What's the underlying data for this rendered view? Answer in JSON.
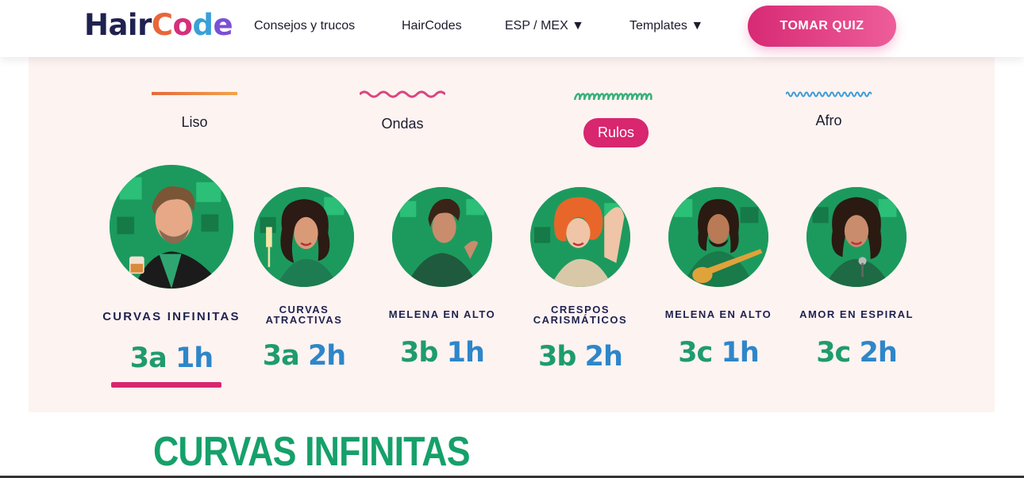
{
  "header": {
    "logo": {
      "hair": "Hair",
      "c": "C",
      "o": "o",
      "d": "d",
      "e": "e"
    },
    "nav": [
      {
        "label": "Consejos y trucos"
      },
      {
        "label": "HairCodes"
      },
      {
        "label": "ESP / MEX ▼"
      },
      {
        "label": "Templates ▼"
      }
    ],
    "cta_label": "TOMAR QUIZ"
  },
  "hair_types": [
    {
      "label": "Liso",
      "icon": "straight-line-icon",
      "selected": false
    },
    {
      "label": "Ondas",
      "icon": "wavy-line-icon",
      "selected": false
    },
    {
      "label": "Rulos",
      "icon": "curly-line-icon",
      "selected": true
    },
    {
      "label": "Afro",
      "icon": "coily-line-icon",
      "selected": false
    }
  ],
  "styles": [
    {
      "name": "CURVAS INFINITAS",
      "code_num": "3a",
      "code_sub": "1h",
      "selected": true
    },
    {
      "name_lines": [
        "CURVAS",
        "ATRACTIVAS"
      ],
      "code_num": "3a",
      "code_sub": "2h"
    },
    {
      "name": "MELENA EN ALTO",
      "code_num": "3b",
      "code_sub": "1h"
    },
    {
      "name_lines": [
        "CRESPOS",
        "CARISMÁTICOS"
      ],
      "code_num": "3b",
      "code_sub": "2h"
    },
    {
      "name": "MELENA EN ALTO",
      "code_num": "3c",
      "code_sub": "1h"
    },
    {
      "name": "AMOR EN ESPIRAL",
      "code_num": "3c",
      "code_sub": "2h"
    }
  ],
  "section_title": "CURVAS INFINITAS",
  "colors": {
    "accent": "#d8266f",
    "green": "#1fa063",
    "panel": "#fdf3f1",
    "navy": "#1f2150"
  }
}
